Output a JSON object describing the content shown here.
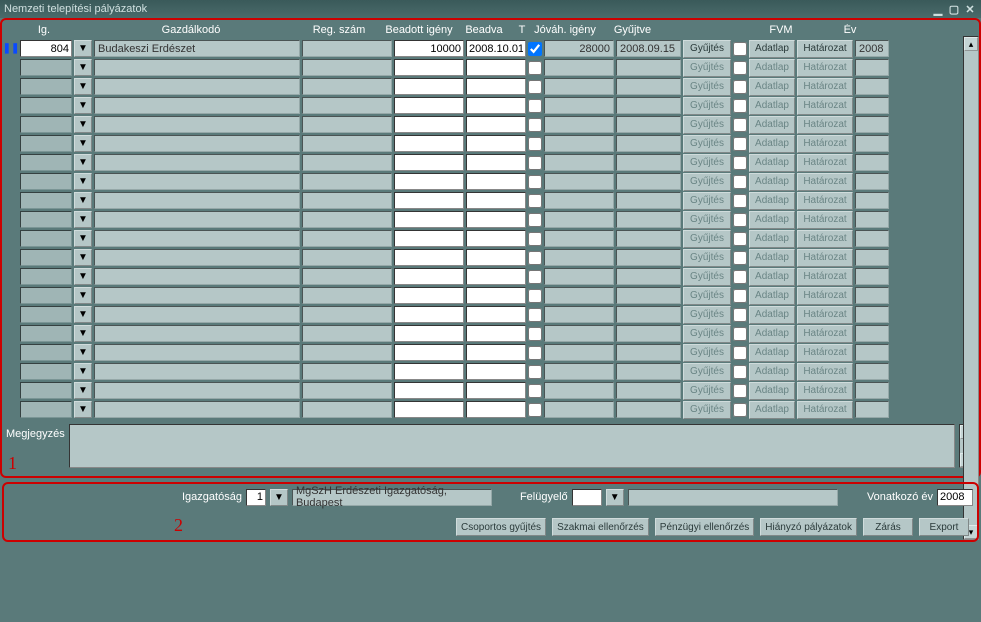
{
  "window": {
    "title": "Nemzeti telepítési pályázatok"
  },
  "columns": {
    "ig": "Ig.",
    "gazdalkodo": "Gazdálkodó",
    "regszam": "Reg. szám",
    "beadott_igeny": "Beadott igény",
    "beadva": "Beadva",
    "t": "T",
    "jovah_igeny": "Jóváh. igény",
    "gyujtve": "Gyűjtve",
    "fvm": "FVM",
    "ev": "Év"
  },
  "rows": [
    {
      "active": true,
      "checked": true,
      "ig": "804",
      "gazdalkodo": "Budakeszi Erdészet",
      "regszam": "",
      "beadott_igeny": "10000",
      "beadva": "2008.10.01",
      "t": true,
      "jovah_igeny": "28000",
      "gyujtve": "2008.09.15",
      "fvm": false,
      "ev": "2008"
    },
    {},
    {},
    {},
    {},
    {},
    {},
    {},
    {},
    {},
    {},
    {},
    {},
    {},
    {},
    {},
    {},
    {},
    {},
    {}
  ],
  "buttons": {
    "gyujtes": "Gyűjtés",
    "adatlap": "Adatlap",
    "hatarozat": "Határozat"
  },
  "megjegyzes": {
    "label": "Megjegyzés",
    "value": ""
  },
  "bottom": {
    "igazgatosag_label": "Igazgatóság",
    "igazgatosag_value": "1",
    "igazgatosag_name": "MgSzH Erdészeti Igazgatóság, Budapest",
    "felugyelo_label": "Felügyelő",
    "felugyelo_value": "",
    "felugyelo_name": "",
    "vonatkozo_ev_label": "Vonatkozó év",
    "vonatkozo_ev_value": "2008"
  },
  "actions": {
    "csoportos": "Csoportos gyűjtés",
    "szakmai": "Szakmai ellenőrzés",
    "penzugyi": "Pénzügyi ellenőrzés",
    "hianyzo": "Hiányzó pályázatok",
    "zaras": "Zárás",
    "export": "Export"
  },
  "markers": {
    "section1": "1",
    "section2": "2"
  }
}
